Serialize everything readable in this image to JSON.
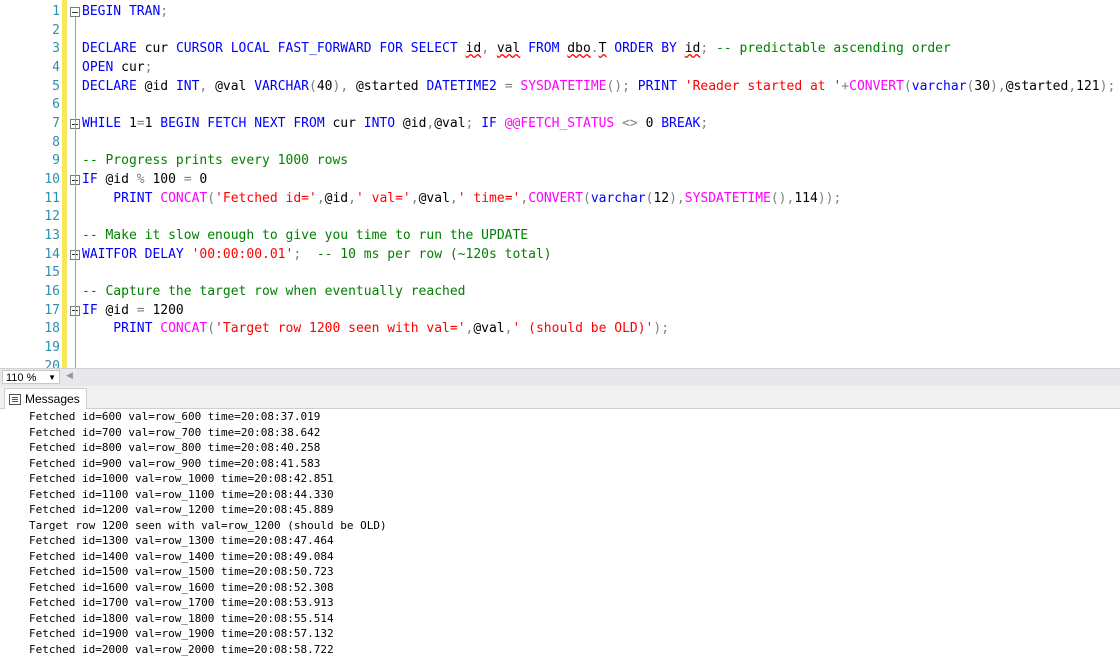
{
  "editor": {
    "lines": [
      {
        "num": "1",
        "tokens": [
          {
            "t": "BEGIN TRAN",
            "c": "kw"
          },
          {
            "t": ";",
            "c": "gr"
          }
        ]
      },
      {
        "num": "2",
        "tokens": []
      },
      {
        "num": "3",
        "tokens": [
          {
            "t": "DECLARE ",
            "c": "kw"
          },
          {
            "t": "cur ",
            "c": "tx"
          },
          {
            "t": "CURSOR LOCAL FAST_FORWARD FOR SELECT ",
            "c": "kw"
          },
          {
            "t": "id",
            "c": "sq"
          },
          {
            "t": ", ",
            "c": "gr"
          },
          {
            "t": "val",
            "c": "sq"
          },
          {
            "t": " ",
            "c": "tx"
          },
          {
            "t": "FROM ",
            "c": "kw"
          },
          {
            "t": "dbo",
            "c": "sq"
          },
          {
            "t": ".",
            "c": "gr"
          },
          {
            "t": "T",
            "c": "sq"
          },
          {
            "t": " ",
            "c": "tx"
          },
          {
            "t": "ORDER BY ",
            "c": "kw"
          },
          {
            "t": "id",
            "c": "sq"
          },
          {
            "t": "; ",
            "c": "gr"
          },
          {
            "t": "-- predictable ascending order",
            "c": "cm"
          }
        ]
      },
      {
        "num": "4",
        "tokens": [
          {
            "t": "OPEN ",
            "c": "kw"
          },
          {
            "t": "cur",
            "c": "tx"
          },
          {
            "t": ";",
            "c": "gr"
          }
        ]
      },
      {
        "num": "5",
        "tokens": [
          {
            "t": "DECLARE ",
            "c": "kw"
          },
          {
            "t": "@id ",
            "c": "tx"
          },
          {
            "t": "INT",
            "c": "kw"
          },
          {
            "t": ", ",
            "c": "gr"
          },
          {
            "t": "@val ",
            "c": "tx"
          },
          {
            "t": "VARCHAR",
            "c": "kw"
          },
          {
            "t": "(",
            "c": "gr"
          },
          {
            "t": "40",
            "c": "tx"
          },
          {
            "t": "), ",
            "c": "gr"
          },
          {
            "t": "@started ",
            "c": "tx"
          },
          {
            "t": "DATETIME2 ",
            "c": "kw"
          },
          {
            "t": "= ",
            "c": "gr"
          },
          {
            "t": "SYSDATETIME",
            "c": "fn"
          },
          {
            "t": "(); ",
            "c": "gr"
          },
          {
            "t": "PRINT ",
            "c": "kw"
          },
          {
            "t": "'Reader started at '",
            "c": "str"
          },
          {
            "t": "+",
            "c": "gr"
          },
          {
            "t": "CONVERT",
            "c": "fn"
          },
          {
            "t": "(",
            "c": "gr"
          },
          {
            "t": "varchar",
            "c": "kw"
          },
          {
            "t": "(",
            "c": "gr"
          },
          {
            "t": "30",
            "c": "tx"
          },
          {
            "t": "),",
            "c": "gr"
          },
          {
            "t": "@started",
            "c": "tx"
          },
          {
            "t": ",",
            "c": "gr"
          },
          {
            "t": "121",
            "c": "tx"
          },
          {
            "t": ");",
            "c": "gr"
          }
        ]
      },
      {
        "num": "6",
        "tokens": []
      },
      {
        "num": "7",
        "tokens": [
          {
            "t": "WHILE ",
            "c": "kw"
          },
          {
            "t": "1",
            "c": "tx"
          },
          {
            "t": "=",
            "c": "gr"
          },
          {
            "t": "1 ",
            "c": "tx"
          },
          {
            "t": "BEGIN FETCH NEXT FROM ",
            "c": "kw"
          },
          {
            "t": "cur ",
            "c": "tx"
          },
          {
            "t": "INTO ",
            "c": "kw"
          },
          {
            "t": "@id",
            "c": "tx"
          },
          {
            "t": ",",
            "c": "gr"
          },
          {
            "t": "@val",
            "c": "tx"
          },
          {
            "t": "; ",
            "c": "gr"
          },
          {
            "t": "IF ",
            "c": "kw"
          },
          {
            "t": "@@FETCH_STATUS ",
            "c": "fn"
          },
          {
            "t": "<> ",
            "c": "gr"
          },
          {
            "t": "0 ",
            "c": "tx"
          },
          {
            "t": "BREAK",
            "c": "kw"
          },
          {
            "t": ";",
            "c": "gr"
          }
        ]
      },
      {
        "num": "8",
        "tokens": []
      },
      {
        "num": "9",
        "tokens": [
          {
            "t": "-- Progress prints every 1000 rows",
            "c": "cm"
          }
        ]
      },
      {
        "num": "10",
        "tokens": [
          {
            "t": "IF ",
            "c": "kw"
          },
          {
            "t": "@id ",
            "c": "tx"
          },
          {
            "t": "% ",
            "c": "gr"
          },
          {
            "t": "100 ",
            "c": "tx"
          },
          {
            "t": "= ",
            "c": "gr"
          },
          {
            "t": "0",
            "c": "tx"
          }
        ]
      },
      {
        "num": "11",
        "tokens": [
          {
            "t": "    PRINT ",
            "c": "kw"
          },
          {
            "t": "CONCAT",
            "c": "fn"
          },
          {
            "t": "(",
            "c": "gr"
          },
          {
            "t": "'Fetched id='",
            "c": "str"
          },
          {
            "t": ",",
            "c": "gr"
          },
          {
            "t": "@id",
            "c": "tx"
          },
          {
            "t": ",",
            "c": "gr"
          },
          {
            "t": "' val='",
            "c": "str"
          },
          {
            "t": ",",
            "c": "gr"
          },
          {
            "t": "@val",
            "c": "tx"
          },
          {
            "t": ",",
            "c": "gr"
          },
          {
            "t": "' time='",
            "c": "str"
          },
          {
            "t": ",",
            "c": "gr"
          },
          {
            "t": "CONVERT",
            "c": "fn"
          },
          {
            "t": "(",
            "c": "gr"
          },
          {
            "t": "varchar",
            "c": "kw"
          },
          {
            "t": "(",
            "c": "gr"
          },
          {
            "t": "12",
            "c": "tx"
          },
          {
            "t": "),",
            "c": "gr"
          },
          {
            "t": "SYSDATETIME",
            "c": "fn"
          },
          {
            "t": "(),",
            "c": "gr"
          },
          {
            "t": "114",
            "c": "tx"
          },
          {
            "t": "));",
            "c": "gr"
          }
        ]
      },
      {
        "num": "12",
        "tokens": []
      },
      {
        "num": "13",
        "tokens": [
          {
            "t": "-- Make it slow enough to give you time to run the UPDATE",
            "c": "cm"
          }
        ]
      },
      {
        "num": "14",
        "tokens": [
          {
            "t": "WAITFOR DELAY ",
            "c": "kw"
          },
          {
            "t": "'00:00:00.01'",
            "c": "str"
          },
          {
            "t": ";  ",
            "c": "gr"
          },
          {
            "t": "-- 10 ms per row (~120s total)",
            "c": "cm"
          }
        ]
      },
      {
        "num": "15",
        "tokens": []
      },
      {
        "num": "16",
        "tokens": [
          {
            "t": "-- Capture the target row when eventually reached",
            "c": "cm"
          }
        ]
      },
      {
        "num": "17",
        "tokens": [
          {
            "t": "IF ",
            "c": "kw"
          },
          {
            "t": "@id ",
            "c": "tx"
          },
          {
            "t": "= ",
            "c": "gr"
          },
          {
            "t": "1200",
            "c": "tx"
          }
        ]
      },
      {
        "num": "18",
        "tokens": [
          {
            "t": "    PRINT ",
            "c": "kw"
          },
          {
            "t": "CONCAT",
            "c": "fn"
          },
          {
            "t": "(",
            "c": "gr"
          },
          {
            "t": "'Target row 1200 seen with val='",
            "c": "str"
          },
          {
            "t": ",",
            "c": "gr"
          },
          {
            "t": "@val",
            "c": "tx"
          },
          {
            "t": ",",
            "c": "gr"
          },
          {
            "t": "' (should be OLD)'",
            "c": "str"
          },
          {
            "t": ");",
            "c": "gr"
          }
        ]
      },
      {
        "num": "19",
        "tokens": []
      },
      {
        "num": "20",
        "tokens": []
      }
    ]
  },
  "zoom": {
    "value": "110 %"
  },
  "results": {
    "tab_label": "Messages"
  },
  "messages": [
    "Fetched id=600 val=row_600 time=20:08:37.019",
    "Fetched id=700 val=row_700 time=20:08:38.642",
    "Fetched id=800 val=row_800 time=20:08:40.258",
    "Fetched id=900 val=row_900 time=20:08:41.583",
    "Fetched id=1000 val=row_1000 time=20:08:42.851",
    "Fetched id=1100 val=row_1100 time=20:08:44.330",
    "Fetched id=1200 val=row_1200 time=20:08:45.889",
    "Target row 1200 seen with val=row_1200 (should be OLD)",
    "Fetched id=1300 val=row_1300 time=20:08:47.464",
    "Fetched id=1400 val=row_1400 time=20:08:49.084",
    "Fetched id=1500 val=row_1500 time=20:08:50.723",
    "Fetched id=1600 val=row_1600 time=20:08:52.308",
    "Fetched id=1700 val=row_1700 time=20:08:53.913",
    "Fetched id=1800 val=row_1800 time=20:08:55.514",
    "Fetched id=1900 val=row_1900 time=20:08:57.132",
    "Fetched id=2000 val=row_2000 time=20:08:58.722"
  ]
}
